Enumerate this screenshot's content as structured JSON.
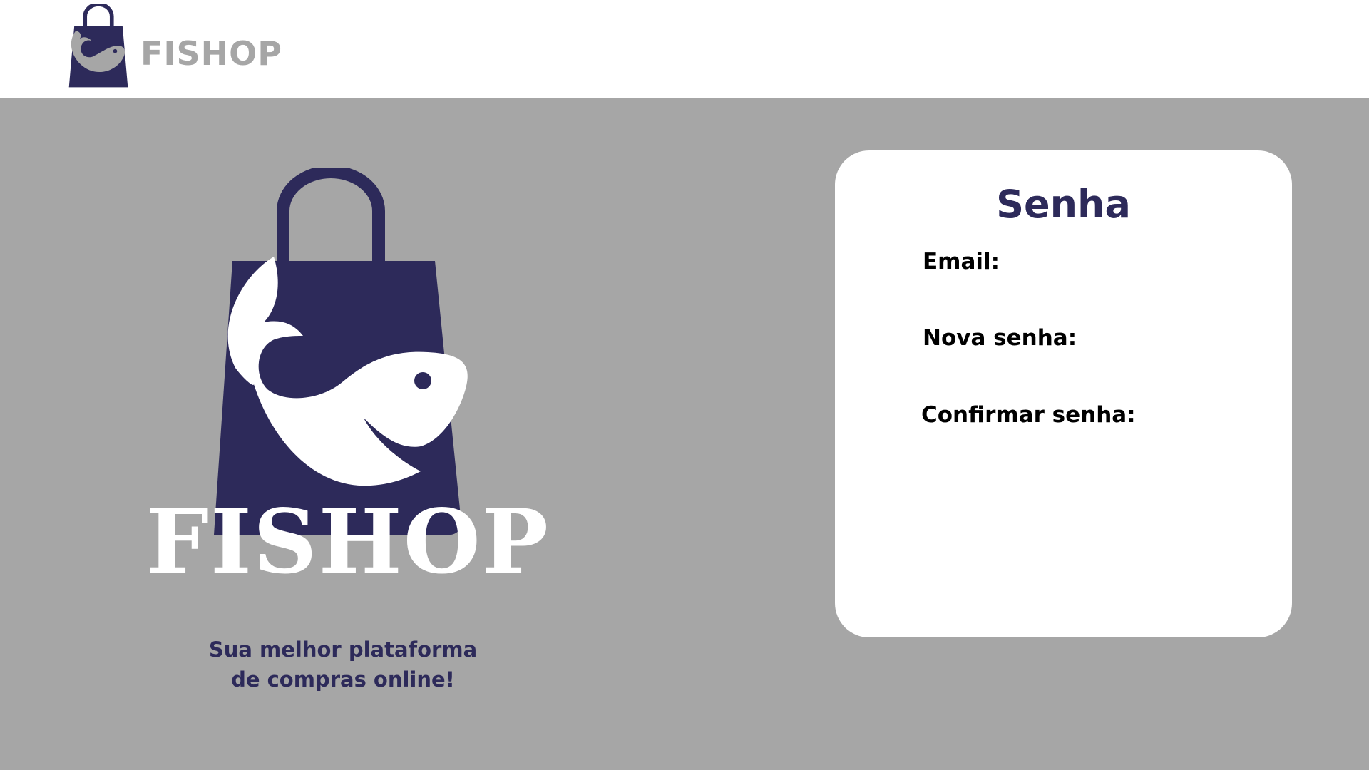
{
  "header": {
    "brand": "FISHOP"
  },
  "hero": {
    "brand": "FISHOP",
    "tagline_line1": "Sua melhor plataforma",
    "tagline_line2": "de compras online!"
  },
  "form": {
    "title": "Senha",
    "fields": [
      {
        "label": "Email:"
      },
      {
        "label": "Nova senha:"
      },
      {
        "label": "Confirmar senha:"
      }
    ]
  },
  "colors": {
    "navy": "#2d2a5a",
    "gray": "#a6a6a6",
    "white": "#ffffff"
  }
}
